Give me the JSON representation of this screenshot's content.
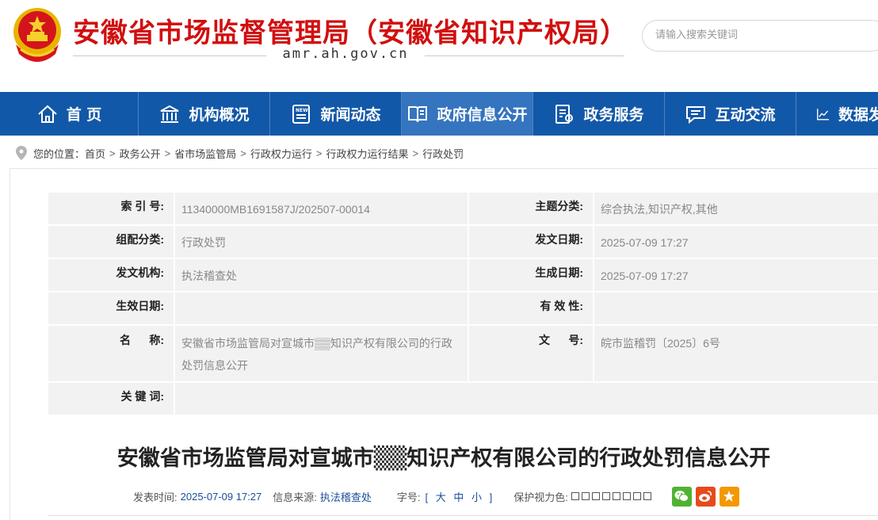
{
  "header": {
    "site_title": "安徽省市场监督管理局（安徽省知识产权局）",
    "domain": "amr.ah.gov.cn",
    "search_placeholder": "请输入搜索关键词"
  },
  "nav": {
    "items": [
      {
        "label": "首 页",
        "icon": "home-icon"
      },
      {
        "label": "机构概况",
        "icon": "building-icon"
      },
      {
        "label": "新闻动态",
        "icon": "news-icon"
      },
      {
        "label": "政府信息公开",
        "icon": "open-book-icon"
      },
      {
        "label": "政务服务",
        "icon": "service-icon"
      },
      {
        "label": "互动交流",
        "icon": "chat-icon"
      },
      {
        "label": "数据发",
        "icon": "chart-icon"
      }
    ],
    "active_index": 3
  },
  "breadcrumb": {
    "prefix": "您的位置：",
    "items": [
      "首页",
      "政务公开",
      "省市场监管局",
      "行政权力运行",
      "行政权力运行结果",
      "行政处罚"
    ],
    "separator": ">"
  },
  "info": {
    "index_no_label": "索 引 号:",
    "index_no": "11340000MB1691587J/202507-00014",
    "topic_label": "主题分类:",
    "topic": "综合执法,知识产权,其他",
    "org_cat_label": "组配分类:",
    "org_cat": "行政处罚",
    "issue_date_label": "发文日期:",
    "issue_date": "2025-07-09 17:27",
    "issuer_label": "发文机构:",
    "issuer": "执法稽查处",
    "gen_date_label": "生成日期:",
    "gen_date": "2025-07-09 17:27",
    "effective_date_label": "生效日期:",
    "effective_date": "",
    "validity_label": "有 效 性:",
    "validity": "",
    "name_label": "名      称:",
    "name": "安徽省市场监管局对宣城市▒▒知识产权有限公司的行政处罚信息公开",
    "doc_no_label": "文      号:",
    "doc_no": "皖市监稽罚〔2025〕6号",
    "keywords_label": "关 键 词:",
    "keywords": ""
  },
  "article": {
    "title": "安徽省市场监管局对宣城市▒▒知识产权有限公司的行政处罚信息公开",
    "publish_label": "发表时间:",
    "publish_time": "2025-07-09 17:27",
    "source_label": "信息来源:",
    "source": "执法稽查处",
    "font_label": "字号:",
    "font_sizes": "[ 大 中 小 ]",
    "eye_label": "保护视力色:"
  },
  "colors": {
    "brand_red": "#d10f0f",
    "nav_blue": "#1258a8",
    "nav_active": "#3574bf",
    "wechat": "#50b233",
    "weibo": "#e8491d",
    "favorite": "#f39800"
  }
}
